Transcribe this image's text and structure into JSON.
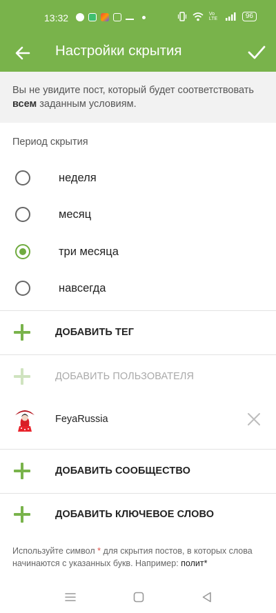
{
  "status_bar": {
    "time": "13:32",
    "battery": "96",
    "network_label": "Vo LTE"
  },
  "app_bar": {
    "title": "Настройки скрытия",
    "back_icon": "arrow-back-icon",
    "confirm_icon": "check-icon"
  },
  "info": {
    "text_before": "Вы не увидите пост, который будет соответствовать ",
    "text_bold": "всем",
    "text_after": " заданным условиям."
  },
  "period": {
    "label": "Период скрытия",
    "options": [
      {
        "label": "неделя",
        "checked": false
      },
      {
        "label": "месяц",
        "checked": false
      },
      {
        "label": "три месяца",
        "checked": true
      },
      {
        "label": "навсегда",
        "checked": false
      }
    ]
  },
  "actions": {
    "add_tag": "ДОБАВИТЬ ТЕГ",
    "add_user": "ДОБАВИТЬ ПОЛЬЗОВАТЕЛЯ",
    "add_community": "ДОБАВИТЬ СООБЩЕСТВО",
    "add_keyword": "ДОБАВИТЬ КЛЮЧЕВОЕ СЛОВО"
  },
  "users": [
    {
      "name": "FeyaRussia"
    }
  ],
  "hint": {
    "before": "Используйте символ ",
    "star": "*",
    "middle": " для скрытия постов, в которых слова начинаются с указанных букв. Например: ",
    "example": "полит*"
  },
  "colors": {
    "accent": "#79b34b",
    "radio_checked": "#6fab3f",
    "star": "#e0534a"
  }
}
